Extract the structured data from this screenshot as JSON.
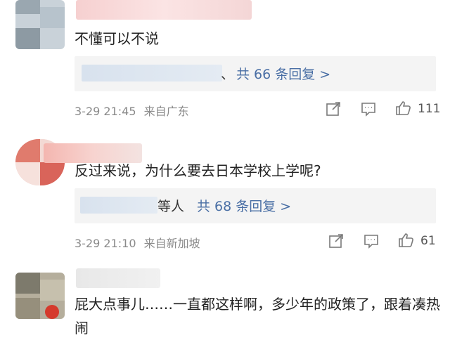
{
  "comments": [
    {
      "text": "不懂可以不说",
      "reply_suffix": "、",
      "reply_more": "共 66 条回复 >",
      "time": "3-29 21:45",
      "location": "来自广东",
      "likes": "111"
    },
    {
      "text": "反过来说，为什么要去日本学校上学呢?",
      "reply_suffix": "等人",
      "reply_more": "共 68 条回复 >",
      "time": "3-29 21:10",
      "location": "来自新加坡",
      "likes": "61"
    },
    {
      "text": "屁大点事儿……一直都这样啊，多少年的政策了，跟着凑热闹"
    }
  ],
  "icons": {
    "share": "share-icon",
    "comment": "comment-icon",
    "like": "thumbs-up-icon"
  },
  "colors": {
    "reply_link": "#4a6fa5",
    "meta_gray": "#8a8a8a",
    "reply_bg": "#f4f4f4"
  }
}
